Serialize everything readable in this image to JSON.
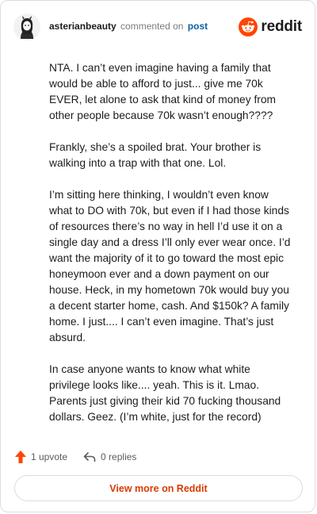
{
  "header": {
    "username": "asterianbeauty",
    "action": "commented on",
    "post_link": "post",
    "brand": "reddit"
  },
  "comment": {
    "paragraphs": [
      "NTA. I can’t even imagine having a family that would be able to afford to just... give me 70k EVER, let alone to ask that kind of money from other people because 70k wasn’t enough????",
      "Frankly, she’s a spoiled brat. Your brother is walking into a trap with that one. Lol.",
      "I’m sitting here thinking, I wouldn’t even know what to DO with 70k, but even if I had those kinds of resources there’s no way in hell I’d use it on a single day and a dress I’ll only ever wear once. I’d want the majority of it to go toward the most epic honeymoon ever and a down payment on our house. Heck, in my hometown 70k would buy you a decent starter home, cash. And $150k? A family home. I just.... I can’t even imagine. That’s just absurd.",
      "In case anyone wants to know what white privilege looks like.... yeah. This is it. Lmao. Parents just giving their kid 70 fucking thousand dollars. Geez. (I’m white, just for the record)"
    ]
  },
  "footer": {
    "upvotes": "1 upvote",
    "replies": "0 replies",
    "view_more": "View more on Reddit"
  },
  "colors": {
    "brand_orange": "#ff4500",
    "link_blue": "#0b61a4",
    "view_more_text": "#d93a00"
  },
  "icons": {
    "avatar": "avatar",
    "logo": "reddit-snoo-icon",
    "upvote": "upvote-arrow-icon",
    "reply": "reply-arrow-icon"
  }
}
